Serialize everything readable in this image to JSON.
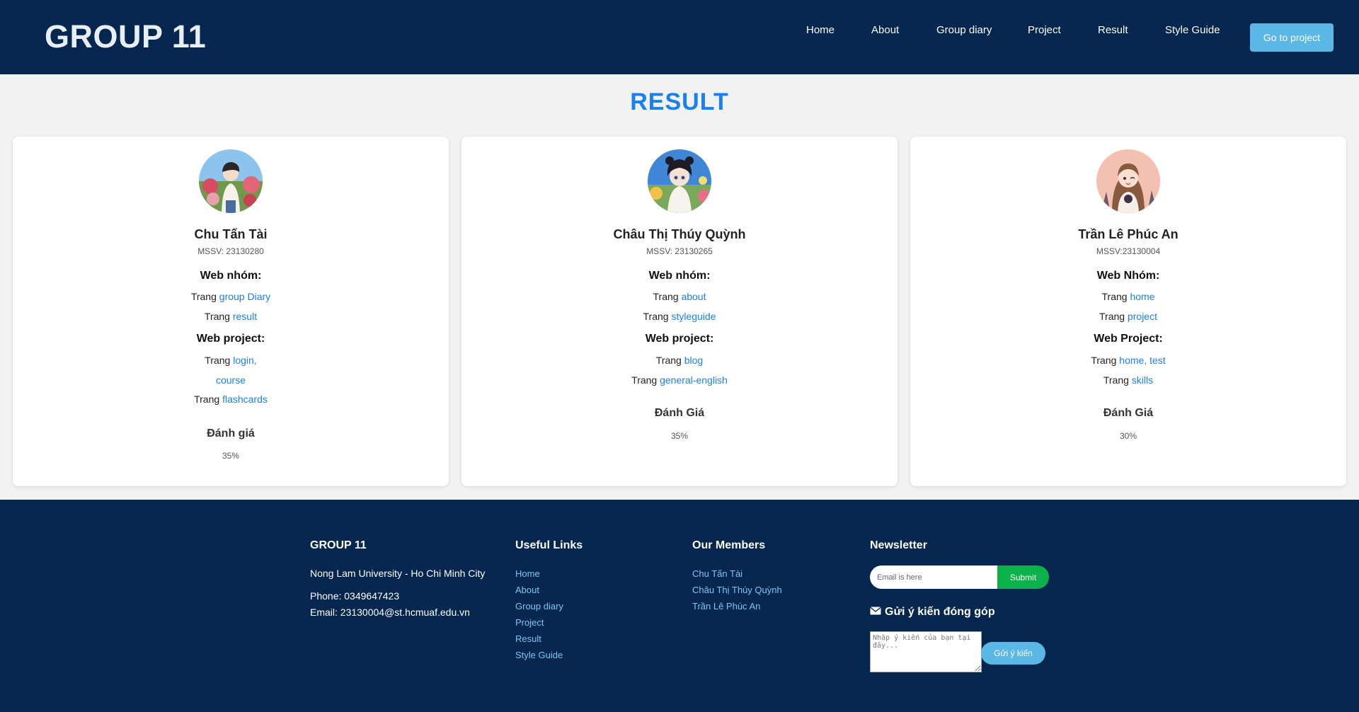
{
  "header": {
    "logo": "GROUP 11",
    "nav": [
      "Home",
      "About",
      "Group diary",
      "Project",
      "Result",
      "Style Guide"
    ],
    "cta": "Go to project"
  },
  "main": {
    "title": "RESULT",
    "members": [
      {
        "name": "Chu Tấn Tài",
        "mssv": "MSSV: 23130280",
        "group_title": "Web nhóm:",
        "group_pages": [
          {
            "prefix": "Trang",
            "link": "group Diary"
          },
          {
            "prefix": "Trang",
            "link": "result"
          }
        ],
        "project_title": "Web project:",
        "project_pages": [
          {
            "prefix": "Trang",
            "link": "login,"
          },
          {
            "prefix": "",
            "link": "course"
          },
          {
            "prefix": "Trang",
            "link": "flashcards"
          }
        ],
        "rating_title": "Đánh giá",
        "rating": "35%"
      },
      {
        "name": "Châu Thị Thúy Quỳnh",
        "mssv": "MSSV: 23130265",
        "group_title": "Web nhóm:",
        "group_pages": [
          {
            "prefix": "Trang",
            "link": "about"
          },
          {
            "prefix": "Trang",
            "link": "styleguide"
          }
        ],
        "project_title": "Web project:",
        "project_pages": [
          {
            "prefix": "Trang",
            "link": "blog"
          },
          {
            "prefix": "Trang",
            "link": "general-english"
          }
        ],
        "rating_title": "Đánh Giá",
        "rating": "35%"
      },
      {
        "name": "Trần Lê Phúc An",
        "mssv": "MSSV:23130004",
        "group_title": "Web Nhóm:",
        "group_pages": [
          {
            "prefix": "Trang",
            "link": "home"
          },
          {
            "prefix": "Trang",
            "link": "project"
          }
        ],
        "project_title": "Web Project:",
        "project_pages": [
          {
            "prefix": "Trang",
            "link": "home, test"
          },
          {
            "prefix": "Trang",
            "link": "skills"
          }
        ],
        "rating_title": "Đánh Giá",
        "rating": "30%"
      }
    ]
  },
  "footer": {
    "about_title": "GROUP 11",
    "university": "Nong Lam University - Ho Chi Minh City",
    "phone": "Phone: 0349647423",
    "email": "Email: 23130004@st.hcmuaf.edu.vn",
    "links_title": "Useful Links",
    "links": [
      "Home",
      "About",
      "Group diary",
      "Project",
      "Result",
      "Style Guide"
    ],
    "members_title": "Our Members",
    "members": [
      "Chu Tấn Tài",
      "Châu Thị Thúy Quỳnh",
      "Trần Lê Phúc An"
    ],
    "newsletter_title": "Newsletter",
    "email_placeholder": "Email is here",
    "submit_label": "Submit",
    "feedback_title": "Gửi ý kiến đóng góp",
    "feedback_placeholder": "Nhập ý kiến của bạn tại đây...",
    "send_label": "Gửi ý kiến"
  },
  "colors": {
    "navy": "#04264f",
    "accent_blue": "#1a7ff0",
    "button_blue": "#5bb7e6",
    "submit_green": "#0bb24a",
    "footer_link": "#7cc6f2"
  },
  "icons": [
    "envelope-icon"
  ]
}
